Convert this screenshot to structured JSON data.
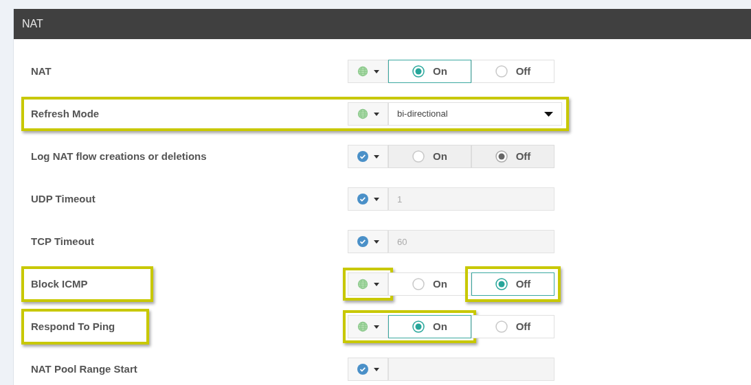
{
  "panel": {
    "title": "NAT"
  },
  "rows": [
    {
      "label": "NAT",
      "global_scope": true,
      "kind": "toggle",
      "disabled": false,
      "options": [
        {
          "label": "On",
          "selected": true
        },
        {
          "label": "Off",
          "selected": false
        }
      ]
    },
    {
      "label": "Refresh Mode",
      "global_scope": true,
      "kind": "select",
      "value": "bi-directional",
      "row_highlighted": true
    },
    {
      "label": "Log NAT flow creations or deletions",
      "global_scope": false,
      "kind": "toggle",
      "disabled": true,
      "options": [
        {
          "label": "On",
          "selected": false
        },
        {
          "label": "Off",
          "selected": true
        }
      ]
    },
    {
      "label": "UDP Timeout",
      "global_scope": false,
      "kind": "text",
      "disabled": true,
      "value": "1"
    },
    {
      "label": "TCP Timeout",
      "global_scope": false,
      "kind": "text",
      "disabled": true,
      "value": "60"
    },
    {
      "label": "Block ICMP",
      "global_scope": true,
      "kind": "toggle",
      "disabled": false,
      "label_highlighted": true,
      "scope_highlighted": true,
      "joined_highlight": false,
      "options": [
        {
          "label": "On",
          "selected": false,
          "highlighted": false
        },
        {
          "label": "Off",
          "selected": true,
          "highlighted": true
        }
      ]
    },
    {
      "label": "Respond To Ping",
      "global_scope": true,
      "kind": "toggle",
      "disabled": false,
      "label_highlighted": true,
      "scope_highlighted": true,
      "joined_highlight": true,
      "options": [
        {
          "label": "On",
          "selected": true
        },
        {
          "label": "Off",
          "selected": false
        }
      ]
    },
    {
      "label": "NAT Pool Range Start",
      "global_scope": false,
      "kind": "text",
      "disabled": true
    }
  ]
}
